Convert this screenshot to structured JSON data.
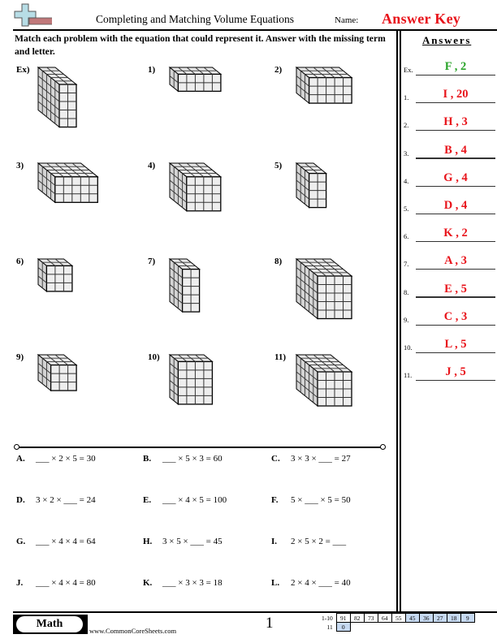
{
  "header": {
    "title": "Completing and Matching Volume Equations",
    "name_label": "Name:",
    "name_value": "Answer Key",
    "logo_icon": "plus-minus-logo-icon"
  },
  "instructions": "Match each problem with the equation that could represent it. Answer with the missing term and letter.",
  "answers": {
    "title": "Answers",
    "items": [
      {
        "num": "Ex.",
        "value": "F , 2"
      },
      {
        "num": "1.",
        "value": "I , 20"
      },
      {
        "num": "2.",
        "value": "H , 3"
      },
      {
        "num": "3.",
        "value": "B , 4"
      },
      {
        "num": "4.",
        "value": "G , 4"
      },
      {
        "num": "5.",
        "value": "D , 4"
      },
      {
        "num": "6.",
        "value": "K , 2"
      },
      {
        "num": "7.",
        "value": "A , 3"
      },
      {
        "num": "8.",
        "value": "E , 5"
      },
      {
        "num": "9.",
        "value": "C , 3"
      },
      {
        "num": "10.",
        "value": "L , 5"
      },
      {
        "num": "11.",
        "value": "J , 5"
      }
    ],
    "colors": {
      "example": "#2aa42a",
      "answer": "#e8141b"
    }
  },
  "problems": [
    {
      "label": "Ex)",
      "cubes": {
        "w": 2,
        "h": 5,
        "d": 5
      }
    },
    {
      "label": "1)",
      "cubes": {
        "w": 5,
        "h": 2,
        "d": 2
      }
    },
    {
      "label": "2)",
      "cubes": {
        "w": 5,
        "h": 3,
        "d": 3
      }
    },
    {
      "label": "3)",
      "cubes": {
        "w": 5,
        "h": 3,
        "d": 4
      }
    },
    {
      "label": "4)",
      "cubes": {
        "w": 4,
        "h": 4,
        "d": 4
      }
    },
    {
      "label": "5)",
      "cubes": {
        "w": 2,
        "h": 4,
        "d": 3
      }
    },
    {
      "label": "6)",
      "cubes": {
        "w": 3,
        "h": 3,
        "d": 2
      }
    },
    {
      "label": "7)",
      "cubes": {
        "w": 2,
        "h": 5,
        "d": 3
      }
    },
    {
      "label": "8)",
      "cubes": {
        "w": 4,
        "h": 5,
        "d": 5
      }
    },
    {
      "label": "9)",
      "cubes": {
        "w": 3,
        "h": 3,
        "d": 3
      }
    },
    {
      "label": "10)",
      "cubes": {
        "w": 4,
        "h": 5,
        "d": 2
      }
    },
    {
      "label": "11)",
      "cubes": {
        "w": 4,
        "h": 4,
        "d": 5
      }
    }
  ],
  "equations": [
    {
      "letter": "A.",
      "text": "___ × 2 × 5 = 30"
    },
    {
      "letter": "B.",
      "text": "___ × 5 × 3 = 60"
    },
    {
      "letter": "C.",
      "text": "3 × 3 × ___ = 27"
    },
    {
      "letter": "D.",
      "text": "3 × 2 × ___ = 24"
    },
    {
      "letter": "E.",
      "text": "___ × 4 × 5 = 100"
    },
    {
      "letter": "F.",
      "text": "5 × ___ × 5 = 50"
    },
    {
      "letter": "G.",
      "text": "___ × 4 × 4 = 64"
    },
    {
      "letter": "H.",
      "text": "3 × 5 × ___ = 45"
    },
    {
      "letter": "I.",
      "text": "2 × 5 × 2 = ___"
    },
    {
      "letter": "J.",
      "text": "___ × 4 × 4 = 80"
    },
    {
      "letter": "K.",
      "text": "___ × 3 × 3 = 18"
    },
    {
      "letter": "L.",
      "text": "2 × 4 × ___ = 40"
    }
  ],
  "footer": {
    "subject": "Math",
    "website": "www.CommonCoreSheets.com",
    "page": "1",
    "score_rows": [
      {
        "label": "1-10",
        "scores": [
          "91",
          "82",
          "73",
          "64",
          "55",
          "45",
          "36",
          "27",
          "18",
          "9"
        ],
        "highlight_from": 5
      },
      {
        "label": "11",
        "scores": [
          "0"
        ],
        "highlight_from": 0
      }
    ]
  }
}
